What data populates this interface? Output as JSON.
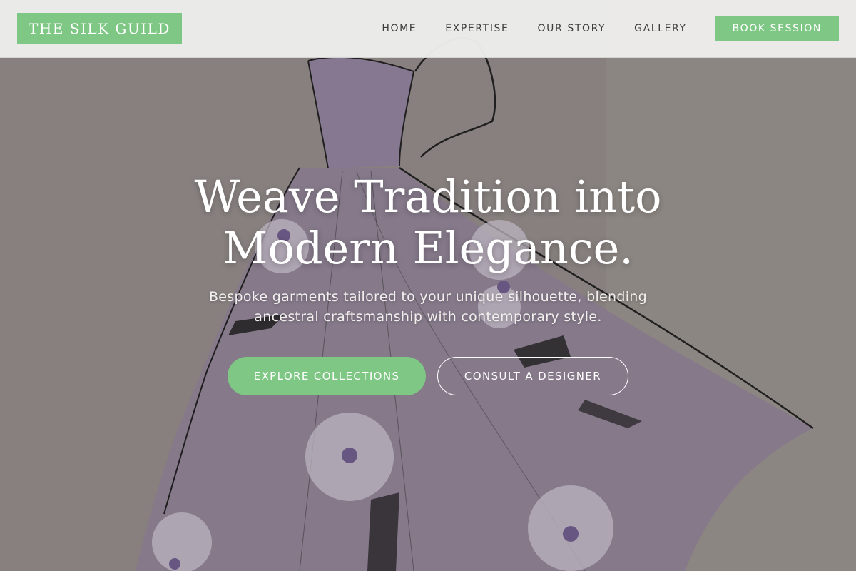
{
  "brand": {
    "name": "THE SILK GUILD"
  },
  "nav": {
    "links": [
      "HOME",
      "EXPERTISE",
      "OUR STORY",
      "GALLERY"
    ],
    "cta": "BOOK SESSION"
  },
  "hero": {
    "title_lines": [
      "Weave Tradition into",
      "Modern Elegance."
    ],
    "subtitle_lines": [
      "Bespoke garments tailored to your unique silhouette, blending",
      "ancestral craftsmanship with contemporary style."
    ],
    "primary_cta": "EXPLORE COLLECTIONS",
    "secondary_cta": "CONSULT A DESIGNER",
    "background_image": "fashion-sketch-purple-gown"
  },
  "colors": {
    "accent": "#7fc784",
    "header_bg": "#eeeeec",
    "text_dark": "#3d3d3d",
    "gown_purple": "#8a7a96"
  }
}
